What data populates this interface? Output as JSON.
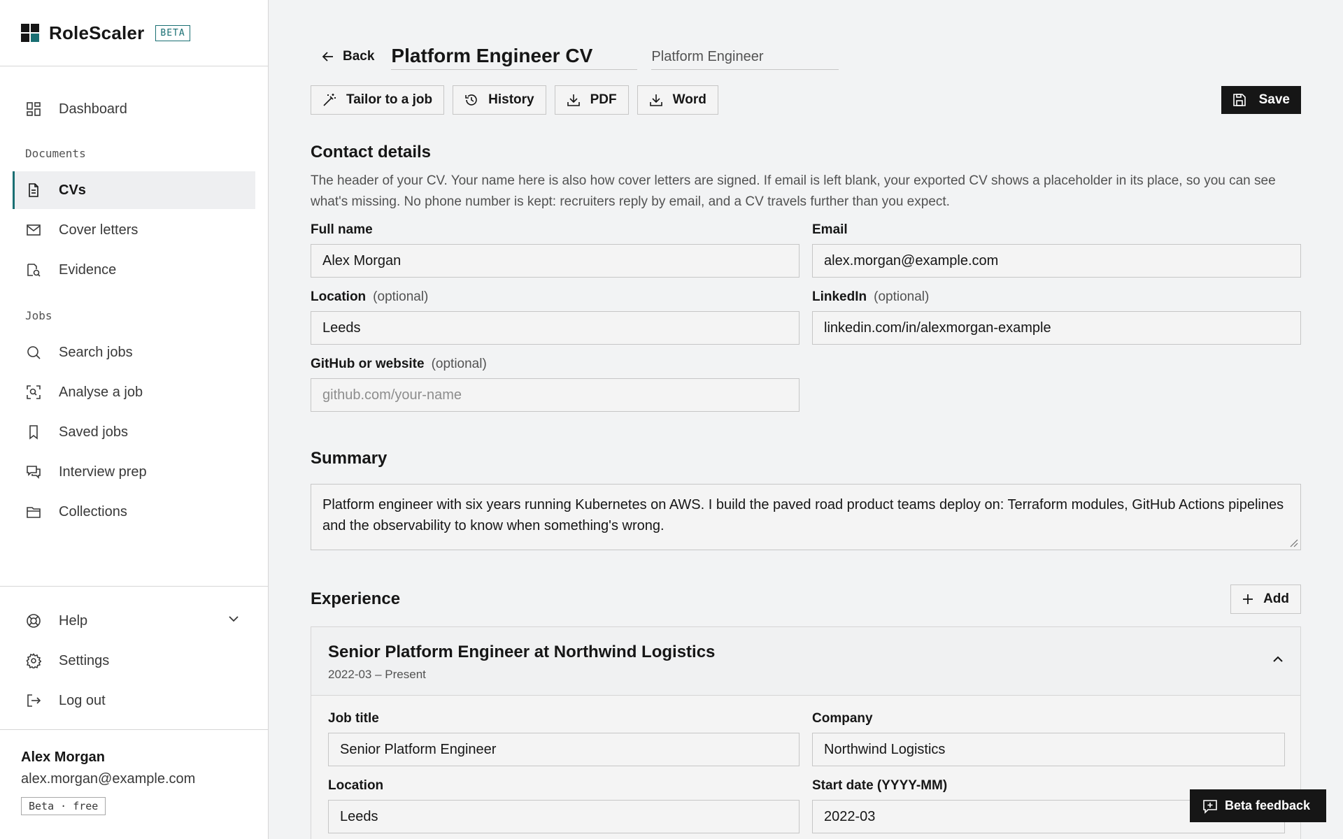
{
  "app": {
    "name": "RoleScaler",
    "badge": "BETA"
  },
  "sidebar": {
    "items": [
      {
        "label": "Dashboard",
        "icon": "dashboard-icon"
      },
      {
        "label": "CVs",
        "icon": "document-icon",
        "active": true
      },
      {
        "label": "Cover letters",
        "icon": "mail-icon"
      },
      {
        "label": "Evidence",
        "icon": "evidence-icon"
      },
      {
        "label": "Search jobs",
        "icon": "search-icon"
      },
      {
        "label": "Analyse a job",
        "icon": "scan-icon"
      },
      {
        "label": "Saved jobs",
        "icon": "bookmark-icon"
      },
      {
        "label": "Interview prep",
        "icon": "chat-icon"
      },
      {
        "label": "Collections",
        "icon": "folder-icon"
      }
    ],
    "headings": {
      "documents": "Documents",
      "jobs": "Jobs"
    },
    "bottom": [
      {
        "label": "Help",
        "icon": "help-icon"
      },
      {
        "label": "Settings",
        "icon": "gear-icon"
      },
      {
        "label": "Log out",
        "icon": "logout-icon"
      }
    ],
    "user": {
      "name": "Alex Morgan",
      "email": "alex.morgan@example.com",
      "plan": "Beta · free"
    }
  },
  "header": {
    "back_label": "Back",
    "title_value": "Platform Engineer CV",
    "role_value": "Platform Engineer"
  },
  "toolbar": {
    "tailor_label": "Tailor to a job",
    "history_label": "History",
    "pdf_label": "PDF",
    "word_label": "Word",
    "save_label": "Save"
  },
  "contact": {
    "title": "Contact details",
    "description": "The header of your CV. Your name here is also how cover letters are signed. If email is left blank, your exported CV shows a placeholder in its place, so you can see what's missing. No phone number is kept: recruiters reply by email, and a CV travels further than you expect.",
    "optional_text": "(optional)",
    "full_name_label": "Full name",
    "full_name_value": "Alex Morgan",
    "email_label": "Email",
    "email_value": "alex.morgan@example.com",
    "location_label": "Location",
    "location_value": "Leeds",
    "linkedin_label": "LinkedIn",
    "linkedin_value": "linkedin.com/in/alexmorgan-example",
    "github_label": "GitHub or website",
    "github_value": "",
    "github_placeholder": "github.com/your-name"
  },
  "summary": {
    "title": "Summary",
    "text": "Platform engineer with six years running Kubernetes on AWS. I build the paved road product teams deploy on: Terraform modules, GitHub Actions pipelines and the observability to know when something's wrong."
  },
  "experience": {
    "title": "Experience",
    "add_label": "Add",
    "entries": [
      {
        "heading": "Senior Platform Engineer at Northwind Logistics",
        "dates": "2022-03 – Present",
        "job_title_label": "Job title",
        "job_title_value": "Senior Platform Engineer",
        "company_label": "Company",
        "company_value": "Northwind Logistics",
        "location_label": "Location",
        "location_value": "Leeds",
        "start_label": "Start date (YYYY-MM)",
        "start_value": "2022-03"
      }
    ]
  },
  "feedback": {
    "label": "Beta feedback"
  },
  "colors": {
    "accent": "#1a6f73",
    "primary_button": "#161616",
    "background": "#f2f3f4"
  }
}
